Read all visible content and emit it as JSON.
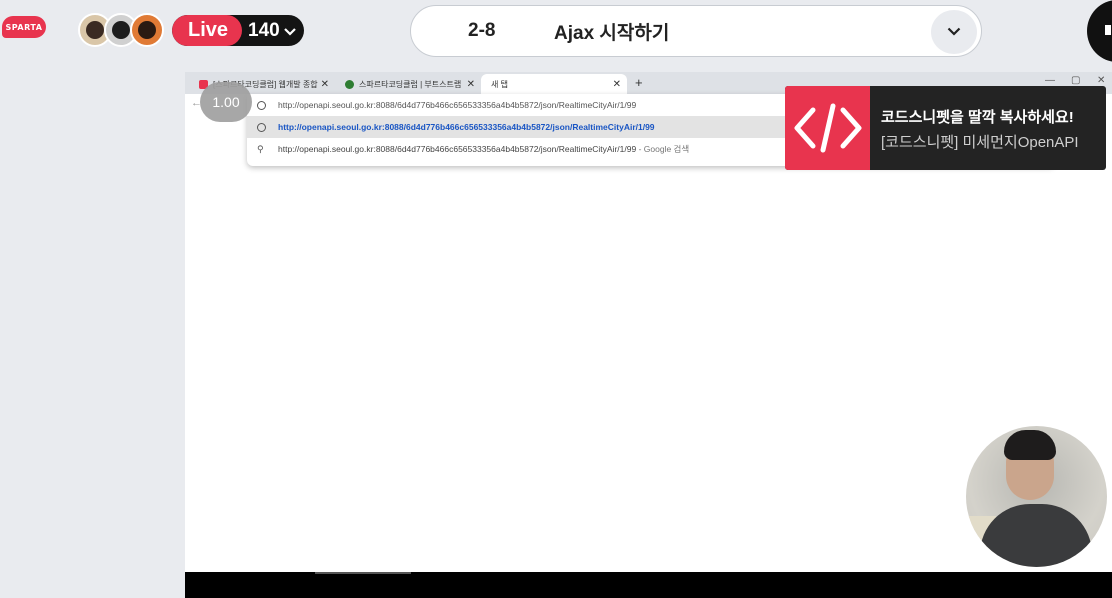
{
  "header": {
    "logo_text": "SPARTA",
    "live_label": "Live",
    "viewer_count": "140",
    "lesson_number": "2-8",
    "lesson_title": "Ajax 시작하기"
  },
  "browser": {
    "tabs": [
      {
        "label": "[스파르타코딩클럽] 웹개발 종합"
      },
      {
        "label": "스파르타코딩클럽 | 부트스트랩"
      },
      {
        "label": "새 탭"
      }
    ],
    "zoom_level": "1.00",
    "omnibox": {
      "input_value": "http://openapi.seoul.go.kr:8088/6d4d776b466c656533356a4b4b5872/json/RealtimeCityAir/1/99",
      "suggestion_url": "http://openapi.seoul.go.kr:8088/6d4d776b466c656533356a4b4b5872/json/RealtimeCityAir/1/99",
      "search_query": "http://openapi.seoul.go.kr:8088/6d4d776b466c656533356a4b4b5872/json/RealtimeCityAir/1/99",
      "search_suffix": " - Google 검색"
    }
  },
  "snippet": {
    "headline": "코드스니펫을 딸깍 복사하세요!",
    "subtitle": "[코드스니펫] 미세먼지OpenAPI"
  },
  "colors": {
    "brand": "#e8344e",
    "link": "#1a56c4",
    "background": "#e9ebef"
  },
  "icons": {
    "chevron": "chevron-down-icon",
    "code": "code-brackets-icon",
    "globe": "globe-icon",
    "search": "search-icon"
  }
}
